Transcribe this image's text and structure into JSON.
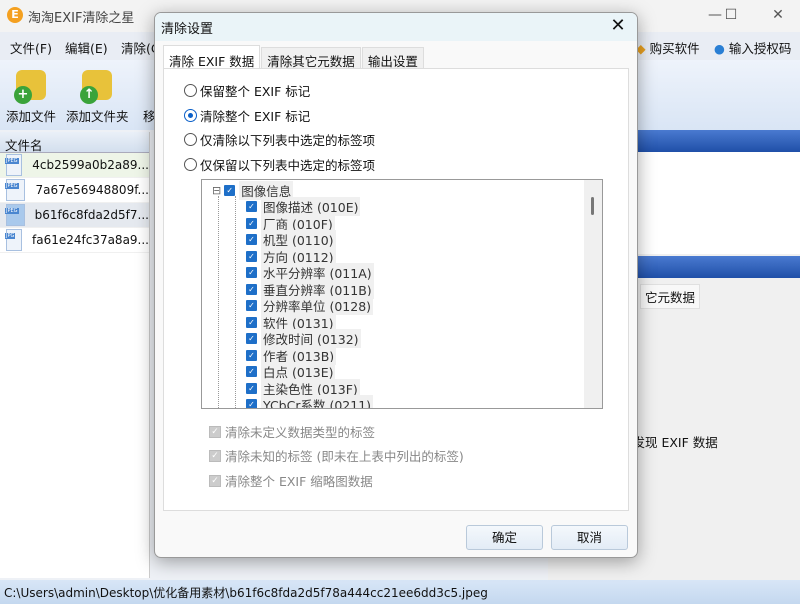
{
  "app": {
    "title": "淘淘EXIF清除之星",
    "logo": "E",
    "minimize": "—",
    "maximize": "☐",
    "close": "✕"
  },
  "menu": [
    "文件(F)",
    "编辑(E)",
    "清除(C"
  ],
  "menu_right": {
    "buy": "购买软件",
    "license": "输入授权码"
  },
  "toolbar": {
    "add_file": "添加文件",
    "add_folder": "添加文件夹",
    "move": "移"
  },
  "file_list": {
    "header": "文件名",
    "files": [
      {
        "name": "4cb2599a0b2a89...",
        "type": "JPEG"
      },
      {
        "name": "7a67e56948809f...",
        "type": "JPEG"
      },
      {
        "name": "b61f6c8fda2d5f7...",
        "type": "JPEG"
      },
      {
        "name": "fa61e24fc37a8a9...",
        "type": "JPG"
      }
    ]
  },
  "right_panel": {
    "tab": "它元数据",
    "no_exif": "未发现 EXIF 数据"
  },
  "status": "C:\\Users\\admin\\Desktop\\优化备用素材\\b61f6c8fda2d5f78a444cc21ee6dd3c5.jpeg",
  "dialog": {
    "title": "清除设置",
    "close": "✕",
    "tabs": [
      "清除 EXIF 数据",
      "清除其它元数据",
      "输出设置"
    ],
    "radios": [
      {
        "label": "保留整个 EXIF 标记",
        "checked": false
      },
      {
        "label": "清除整个 EXIF 标记",
        "checked": true
      },
      {
        "label": "仅清除以下列表中选定的标签项",
        "checked": false
      },
      {
        "label": "仅保留以下列表中选定的标签项",
        "checked": false
      }
    ],
    "tree": {
      "expander": "⊟",
      "root": "图像信息",
      "items": [
        "图像描述 (010E)",
        "厂商 (010F)",
        "机型 (0110)",
        "方向 (0112)",
        "水平分辨率 (011A)",
        "垂直分辨率 (011B)",
        "分辨率单位 (0128)",
        "软件 (0131)",
        "修改时间 (0132)",
        "作者 (013B)",
        "白点 (013E)",
        "主染色性 (013F)",
        "YCbCr系数 (0211)"
      ]
    },
    "options": [
      "清除未定义数据类型的标签",
      "清除未知的标签 (即未在上表中列出的标签)",
      "清除整个 EXIF 缩略图数据"
    ],
    "ok": "确定",
    "cancel": "取消"
  }
}
